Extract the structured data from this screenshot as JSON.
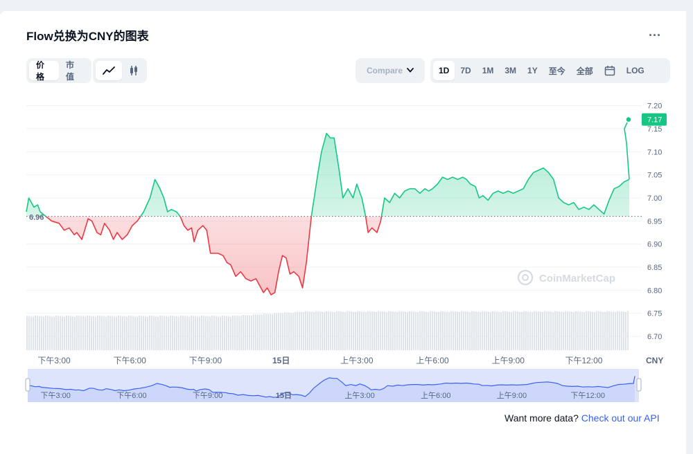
{
  "header": {
    "title": "Flow兑换为CNY的图表",
    "more_label": "..."
  },
  "toolbar": {
    "type_tabs": [
      "价格",
      "市值"
    ],
    "active_type": "价格",
    "style_icons": [
      "line-chart-icon",
      "candlestick-icon"
    ],
    "compare_label": "Compare ",
    "range_tabs": [
      "1D",
      "7D",
      "1M",
      "3M",
      "1Y",
      "至今",
      "全部"
    ],
    "active_range": "1D",
    "calendar_icon": "calendar-icon",
    "log_label": "LOG"
  },
  "footer": {
    "api_prefix": "Want more data? ",
    "api_link": "Check out our API"
  },
  "watermark": "CoinMarketCap",
  "colors": {
    "up": "#16c784",
    "down": "#ea3943",
    "accent": "#3861fb",
    "nav_fill": "#dde4fc"
  },
  "chart_data": {
    "type": "line",
    "currency": "CNY",
    "y_ticks": [
      "7.20",
      "7.15",
      "7.10",
      "7.05",
      "7.00",
      "6.95",
      "6.90",
      "6.85",
      "6.80",
      "6.75",
      "6.70"
    ],
    "ylim": [
      6.67,
      7.21
    ],
    "baseline": 6.96,
    "baseline_label": "6.96",
    "current_value": 7.17,
    "current_label": "7.17",
    "x_ticks": [
      "下午3:00",
      "下午6:00",
      "下午9:00",
      "15日",
      "上午3:00",
      "上午6:00",
      "上午9:00",
      "下午12:00"
    ],
    "x_tick_hours": [
      3,
      6,
      9,
      12,
      15,
      18,
      21,
      24
    ],
    "x_range_hours": [
      1.9,
      25.8
    ],
    "series": [
      {
        "points": [
          [
            1.9,
            6.97
          ],
          [
            2.0,
            7.0
          ],
          [
            2.2,
            6.98
          ],
          [
            2.35,
            6.985
          ],
          [
            2.45,
            6.97
          ],
          [
            2.9,
            6.95
          ],
          [
            3.2,
            6.945
          ],
          [
            3.4,
            6.93
          ],
          [
            3.6,
            6.935
          ],
          [
            3.8,
            6.92
          ],
          [
            3.9,
            6.925
          ],
          [
            4.1,
            6.91
          ],
          [
            4.35,
            6.955
          ],
          [
            4.5,
            6.95
          ],
          [
            4.7,
            6.925
          ],
          [
            4.85,
            6.92
          ],
          [
            5.0,
            6.945
          ],
          [
            5.2,
            6.93
          ],
          [
            5.35,
            6.91
          ],
          [
            5.5,
            6.925
          ],
          [
            5.7,
            6.91
          ],
          [
            5.9,
            6.92
          ],
          [
            6.1,
            6.94
          ],
          [
            6.3,
            6.95
          ],
          [
            6.55,
            6.97
          ],
          [
            6.8,
            7.0
          ],
          [
            7.0,
            7.04
          ],
          [
            7.2,
            7.02
          ],
          [
            7.35,
            7.0
          ],
          [
            7.5,
            6.97
          ],
          [
            7.65,
            6.975
          ],
          [
            7.85,
            6.97
          ],
          [
            8.0,
            6.96
          ],
          [
            8.15,
            6.94
          ],
          [
            8.3,
            6.93
          ],
          [
            8.45,
            6.935
          ],
          [
            8.55,
            6.905
          ],
          [
            8.7,
            6.93
          ],
          [
            8.9,
            6.94
          ],
          [
            9.05,
            6.93
          ],
          [
            9.2,
            6.88
          ],
          [
            9.5,
            6.88
          ],
          [
            9.7,
            6.875
          ],
          [
            9.85,
            6.86
          ],
          [
            10.0,
            6.855
          ],
          [
            10.2,
            6.83
          ],
          [
            10.4,
            6.84
          ],
          [
            10.6,
            6.825
          ],
          [
            10.8,
            6.82
          ],
          [
            11.0,
            6.825
          ],
          [
            11.15,
            6.81
          ],
          [
            11.3,
            6.795
          ],
          [
            11.45,
            6.805
          ],
          [
            11.6,
            6.79
          ],
          [
            11.75,
            6.795
          ],
          [
            11.9,
            6.84
          ],
          [
            12.05,
            6.875
          ],
          [
            12.2,
            6.87
          ],
          [
            12.35,
            6.835
          ],
          [
            12.5,
            6.84
          ],
          [
            12.7,
            6.83
          ],
          [
            12.85,
            6.805
          ],
          [
            13.0,
            6.86
          ],
          [
            13.2,
            6.96
          ],
          [
            13.45,
            7.05
          ],
          [
            13.6,
            7.1
          ],
          [
            13.8,
            7.14
          ],
          [
            13.95,
            7.13
          ],
          [
            14.1,
            7.13
          ],
          [
            14.3,
            7.06
          ],
          [
            14.45,
            7.0
          ],
          [
            14.65,
            7.02
          ],
          [
            14.85,
            7.0
          ],
          [
            15.0,
            7.03
          ],
          [
            15.2,
            7.0
          ],
          [
            15.35,
            6.96
          ],
          [
            15.45,
            6.925
          ],
          [
            15.6,
            6.935
          ],
          [
            15.8,
            6.925
          ],
          [
            15.95,
            6.95
          ],
          [
            16.1,
            7.0
          ],
          [
            16.3,
            6.99
          ],
          [
            16.5,
            7.01
          ],
          [
            16.7,
            7.0
          ],
          [
            16.9,
            7.015
          ],
          [
            17.1,
            7.02
          ],
          [
            17.3,
            7.02
          ],
          [
            17.5,
            7.01
          ],
          [
            17.7,
            7.02
          ],
          [
            17.85,
            7.015
          ],
          [
            18.0,
            7.02
          ],
          [
            18.2,
            7.03
          ],
          [
            18.4,
            7.045
          ],
          [
            18.6,
            7.04
          ],
          [
            18.8,
            7.045
          ],
          [
            19.0,
            7.04
          ],
          [
            19.2,
            7.045
          ],
          [
            19.35,
            7.04
          ],
          [
            19.5,
            7.03
          ],
          [
            19.7,
            7.025
          ],
          [
            19.85,
            7.0
          ],
          [
            20.0,
            7.005
          ],
          [
            20.2,
            6.995
          ],
          [
            20.4,
            7.01
          ],
          [
            20.6,
            7.015
          ],
          [
            20.8,
            7.01
          ],
          [
            21.0,
            7.015
          ],
          [
            21.2,
            7.01
          ],
          [
            21.4,
            7.015
          ],
          [
            21.6,
            7.02
          ],
          [
            21.8,
            7.04
          ],
          [
            22.0,
            7.055
          ],
          [
            22.2,
            7.06
          ],
          [
            22.4,
            7.065
          ],
          [
            22.6,
            7.055
          ],
          [
            22.8,
            7.04
          ],
          [
            23.0,
            7.0
          ],
          [
            23.2,
            6.99
          ],
          [
            23.4,
            6.985
          ],
          [
            23.6,
            6.99
          ],
          [
            23.8,
            6.975
          ],
          [
            24.0,
            6.98
          ],
          [
            24.2,
            6.975
          ],
          [
            24.4,
            6.985
          ],
          [
            24.6,
            6.975
          ],
          [
            24.8,
            6.965
          ],
          [
            25.0,
            6.995
          ],
          [
            25.2,
            7.02
          ],
          [
            25.4,
            7.025
          ],
          [
            25.6,
            7.035
          ],
          [
            25.8,
            7.04
          ]
        ]
      }
    ]
  }
}
